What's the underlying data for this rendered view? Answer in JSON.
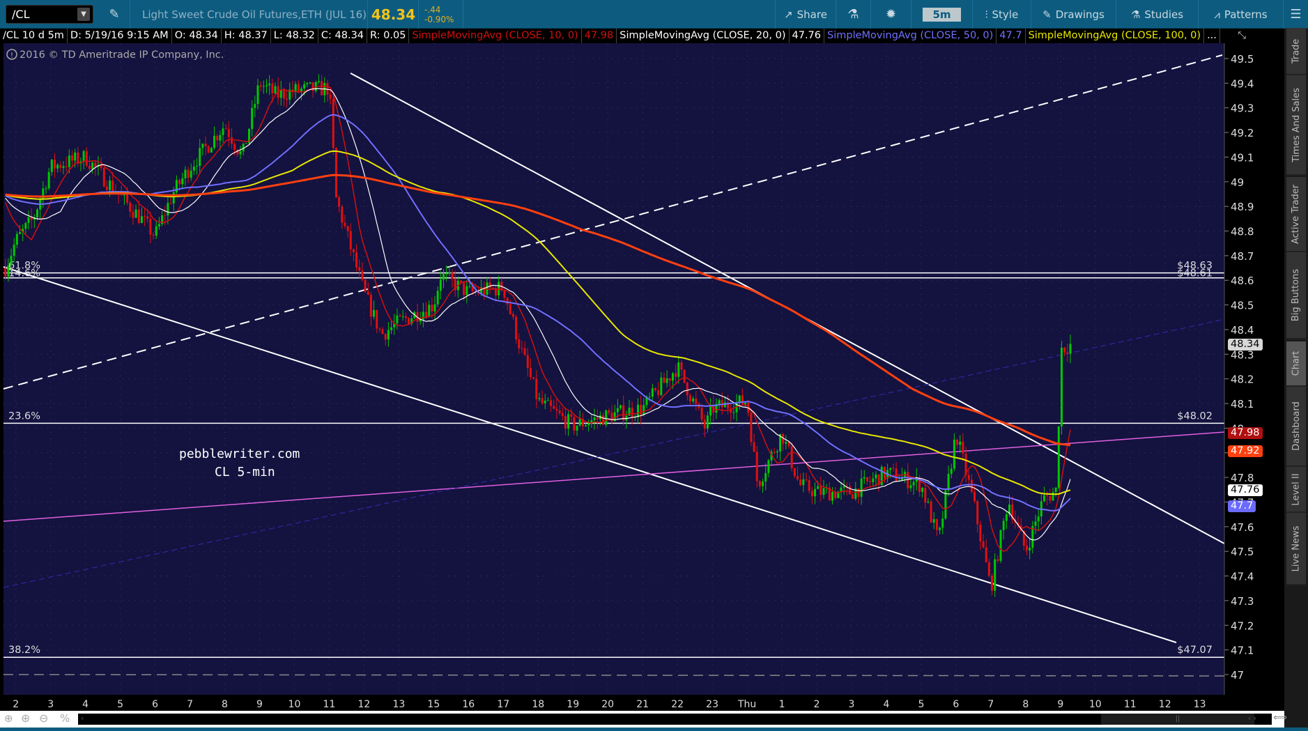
{
  "toolbar": {
    "symbol": "/CL",
    "title": "Light Sweet Crude Oil Futures,ETH (JUL 16)",
    "last_price": "48.34",
    "change": "-.44",
    "change_pct": "-0.90%",
    "share": "Share",
    "timeframe": "5m",
    "style": "Style",
    "drawings": "Drawings",
    "studies": "Studies",
    "patterns": "Patterns"
  },
  "info": {
    "symbol_period": "/CL 10 d 5m",
    "date": "D: 5/19/16 9:15 AM",
    "open": "O: 48.34",
    "high": "H: 48.37",
    "low": "L: 48.32",
    "close": "C: 48.34",
    "range": "R: 0.05",
    "sma10_label": "SimpleMovingAvg (CLOSE, 10, 0)",
    "sma10_value": "47.98",
    "sma20_label": "SimpleMovingAvg (CLOSE, 20, 0)",
    "sma20_value": "47.76",
    "sma50_label": "SimpleMovingAvg (CLOSE, 50, 0)",
    "sma50_value": "47.7",
    "sma100_label": "SimpleMovingAvg (CLOSE, 100, 0)",
    "more": "..."
  },
  "copyright": "2016 © TD Ameritrade IP Company, Inc.",
  "watermark": {
    "line1": "pebblewriter.com",
    "line2": "CL 5-min"
  },
  "fib_levels": [
    {
      "pct": "61.8%",
      "label": "$48.63",
      "price": 48.63
    },
    {
      "pct": "14.6%",
      "label": "$48.61",
      "price": 48.61
    },
    {
      "pct": "23.6%",
      "label": "$48.02",
      "price": 48.02
    },
    {
      "pct": "38.2%",
      "label": "$47.07",
      "price": 47.07
    }
  ],
  "price_tags": [
    {
      "value": "48.34",
      "bg": "#d8d8d8",
      "fg": "#000000"
    },
    {
      "value": "47.98",
      "bg": "#b01010",
      "fg": "#ffffff"
    },
    {
      "value": "47.92",
      "bg": "#ff4010",
      "fg": "#ffffff"
    },
    {
      "value": "47.76",
      "bg": "#ffffff",
      "fg": "#000000"
    },
    {
      "value": "47.7",
      "bg": "#6b6bff",
      "fg": "#ffffff"
    }
  ],
  "sidebar": [
    "Trade",
    "Times And Sales",
    "Active Trader",
    "Big Buttons",
    "Chart",
    "Dashboard",
    "Level II",
    "Live News"
  ],
  "sidebar_active": "Chart",
  "colors": {
    "up": "#00c800",
    "down": "#e01010",
    "sma10": "#d01010",
    "sma20": "#ffffff",
    "sma50": "#7070ff",
    "sma100": "#e8e800",
    "sma200": "#ff4010",
    "bg": "#14123f"
  },
  "chart_data": {
    "type": "candlestick",
    "y_ticks": [
      "49.5",
      "49.4",
      "49.3",
      "49.2",
      "49.1",
      "49",
      "48.9",
      "48.8",
      "48.7",
      "48.6",
      "48.5",
      "48.4",
      "48.3",
      "48.2",
      "48.1",
      "48",
      "47.9",
      "47.8",
      "47.7",
      "47.6",
      "47.5",
      "47.4",
      "47.3",
      "47.2",
      "47.1",
      "47"
    ],
    "ylim": [
      47.0,
      49.5
    ],
    "x_labels": [
      "2",
      "3",
      "4",
      "5",
      "6",
      "7",
      "8",
      "9",
      "10",
      "11",
      "12",
      "13",
      "15",
      "16",
      "17",
      "18",
      "19",
      "20",
      "21",
      "22",
      "23",
      "Thu",
      "1",
      "2",
      "3",
      "4",
      "5",
      "6",
      "7",
      "8",
      "9",
      "10",
      "11",
      "12",
      "13"
    ],
    "price_path": [
      [
        -0.3,
        48.65
      ],
      [
        0,
        48.76
      ],
      [
        0.5,
        48.85
      ],
      [
        1,
        49.06
      ],
      [
        2,
        49.1
      ],
      [
        3,
        48.94
      ],
      [
        3.6,
        48.85
      ],
      [
        4,
        48.78
      ],
      [
        4.5,
        48.95
      ],
      [
        5,
        49.06
      ],
      [
        6,
        49.23
      ],
      [
        6.5,
        49.1
      ],
      [
        7,
        49.4
      ],
      [
        7.5,
        49.35
      ],
      [
        8,
        49.37
      ],
      [
        9,
        49.38
      ],
      [
        9.2,
        48.93
      ],
      [
        10,
        48.55
      ],
      [
        10.5,
        48.38
      ],
      [
        11,
        48.43
      ],
      [
        12,
        48.5
      ],
      [
        12.2,
        48.62
      ],
      [
        13,
        48.55
      ],
      [
        14,
        48.57
      ],
      [
        14.5,
        48.32
      ],
      [
        15,
        48.11
      ],
      [
        16,
        48.01
      ],
      [
        17,
        48.05
      ],
      [
        18,
        48.08
      ],
      [
        19,
        48.25
      ],
      [
        19.8,
        48.0
      ],
      [
        20,
        48.08
      ],
      [
        21,
        48.11
      ],
      [
        21.3,
        47.77
      ],
      [
        22,
        47.98
      ],
      [
        22.5,
        47.77
      ],
      [
        23,
        47.74
      ],
      [
        24,
        47.74
      ],
      [
        25,
        47.82
      ],
      [
        26,
        47.77
      ],
      [
        26.5,
        47.54
      ],
      [
        27,
        47.98
      ],
      [
        27.5,
        47.7
      ],
      [
        28,
        47.35
      ],
      [
        28.5,
        47.71
      ],
      [
        29,
        47.5
      ],
      [
        29.5,
        47.71
      ],
      [
        29.9,
        47.75
      ],
      [
        30,
        48.32
      ],
      [
        30.3,
        48.34
      ]
    ],
    "trend_lines": "descending channel, ascending dashed line, magenta support line"
  }
}
